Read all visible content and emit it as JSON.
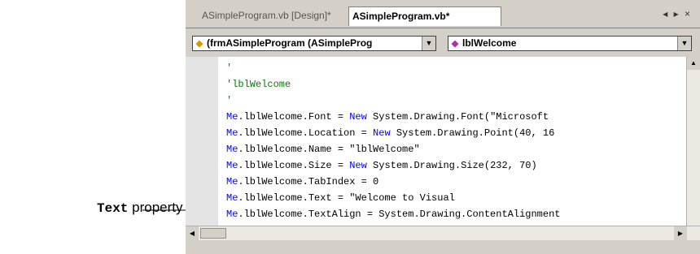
{
  "callout": {
    "code_word": "Text",
    "text_word": "property"
  },
  "tabs": [
    {
      "label": "ASimpleProgram.vb [Design]*"
    },
    {
      "label": "ASimpleProgram.vb*"
    }
  ],
  "tab_controls": "◂ ▸ ×",
  "class_dropdown": {
    "value": "(frmASimpleProgram (ASimpleProg"
  },
  "method_dropdown": {
    "value": "lblWelcome"
  },
  "code_lines": [
    [
      {
        "t": "'",
        "c": "cm"
      }
    ],
    [
      {
        "t": "'lblWelcome",
        "c": "cm"
      }
    ],
    [
      {
        "t": "'",
        "c": "cm"
      }
    ],
    [
      {
        "t": "Me",
        "c": "kw"
      },
      {
        "t": ".lblWelcome.Font = ",
        "c": ""
      },
      {
        "t": "New",
        "c": "kw"
      },
      {
        "t": " System.Drawing.Font(\"Microsoft",
        "c": ""
      }
    ],
    [
      {
        "t": "Me",
        "c": "kw"
      },
      {
        "t": ".lblWelcome.Location = ",
        "c": ""
      },
      {
        "t": "New",
        "c": "kw"
      },
      {
        "t": " System.Drawing.Point(40, 16",
        "c": ""
      }
    ],
    [
      {
        "t": "Me",
        "c": "kw"
      },
      {
        "t": ".lblWelcome.Name = \"lblWelcome\"",
        "c": ""
      }
    ],
    [
      {
        "t": "Me",
        "c": "kw"
      },
      {
        "t": ".lblWelcome.Size = ",
        "c": ""
      },
      {
        "t": "New",
        "c": "kw"
      },
      {
        "t": " System.Drawing.Size(232, 70)",
        "c": ""
      }
    ],
    [
      {
        "t": "Me",
        "c": "kw"
      },
      {
        "t": ".lblWelcome.TabIndex = 0",
        "c": ""
      }
    ],
    [
      {
        "t": "Me",
        "c": "kw"
      },
      {
        "t": ".lblWelcome.Text = \"Welcome to Visual",
        "c": ""
      }
    ],
    [
      {
        "t": "Me",
        "c": "kw"
      },
      {
        "t": ".lblWelcome.TextAlign = System.Drawing.ContentAlignment",
        "c": ""
      }
    ]
  ]
}
